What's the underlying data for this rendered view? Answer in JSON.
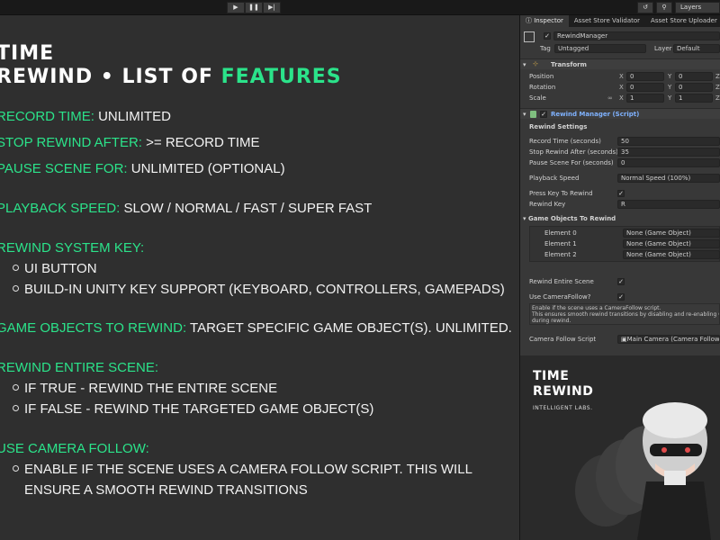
{
  "toolbar": {
    "play_icon": "▶",
    "pause_icon": "❚❚",
    "step_icon": "▶|",
    "history_icon": "↺",
    "search_icon": "⚲",
    "layers_label": "Layers"
  },
  "features": {
    "title_line1": "TIME",
    "title_line2_plain": "REWIND • LIST OF ",
    "title_line2_accent": "FEATURES",
    "record_time_key": "RECORD TIME:",
    "record_time_val": " UNLIMITED",
    "stop_rewind_key": "STOP REWIND AFTER:",
    "stop_rewind_val": " >= RECORD TIME",
    "pause_scene_key": "PAUSE SCENE FOR:",
    "pause_scene_val": " UNLIMITED (OPTIONAL)",
    "playback_key": "PLAYBACK SPEED:",
    "playback_val": " SLOW / NORMAL / FAST / SUPER FAST",
    "system_key_key": "REWIND SYSTEM KEY:",
    "system_key_sub1": "UI BUTTON",
    "system_key_sub2": "BUILD-IN UNITY KEY SUPPORT (KEYBOARD, CONTROLLERS, GAMEPADS)",
    "game_objects_key": "GAME OBJECTS TO REWIND:",
    "game_objects_val": " TARGET SPECIFIC GAME OBJECT(S). UNLIMITED.",
    "entire_scene_key": "REWIND ENTIRE SCENE:",
    "entire_scene_sub1": "IF TRUE  - REWIND THE ENTIRE SCENE",
    "entire_scene_sub2": "IF FALSE - REWIND THE TARGETED GAME OBJECT(S)",
    "camera_key": "USE CAMERA FOLLOW:",
    "camera_sub1": "ENABLE IF THE SCENE USES A CAMERA FOLLOW SCRIPT. THIS WILL",
    "camera_sub2": "ENSURE A SMOOTH REWIND TRANSITIONS"
  },
  "inspector": {
    "tabs": [
      "Inspector",
      "Asset Store Validator",
      "Asset Store Uploader"
    ],
    "object_name": "RewindManager",
    "tag_label": "Tag",
    "tag_value": "Untagged",
    "layer_label": "Layer",
    "layer_value": "Default",
    "transform": {
      "title": "Transform",
      "position_label": "Position",
      "rotation_label": "Rotation",
      "scale_label": "Scale",
      "position": [
        "0",
        "0"
      ],
      "rotation": [
        "0",
        "0"
      ],
      "scale": [
        "1",
        "1"
      ],
      "x": "X",
      "y": "Y",
      "z": "Z"
    },
    "script": {
      "title": "Rewind Manager (Script)",
      "settings_header": "Rewind Settings",
      "record_time_label": "Record Time (seconds)",
      "record_time_value": "50",
      "stop_after_label": "Stop Rewind After (seconds)",
      "stop_after_value": "35",
      "pause_for_label": "Pause Scene For (seconds)",
      "pause_for_value": "0",
      "playback_label": "Playback Speed",
      "playback_value": "Normal Speed (100%)",
      "press_key_label": "Press Key To Rewind",
      "rewind_key_label": "Rewind Key",
      "rewind_key_value": "R",
      "objects_header": "Game Objects To Rewind",
      "elements": [
        {
          "label": "Element 0",
          "value": "None (Game Object)"
        },
        {
          "label": "Element 1",
          "value": "None (Game Object)"
        },
        {
          "label": "Element 2",
          "value": "None (Game Object)"
        }
      ],
      "entire_scene_label": "Rewind Entire Scene",
      "camera_follow_label": "Use CameraFollow?",
      "help_line1": "Enable if the scene uses a CameraFollow script.",
      "help_line2": "This ensures smooth rewind transitions by disabling and re-enabling Came",
      "help_line3": "during rewind.",
      "camera_script_label": "Camera Follow Script",
      "camera_script_value": "Main Camera (Camera Follow)"
    }
  },
  "brand": {
    "line1": "TIME",
    "line2": "REWIND",
    "sub": "INTELLIGENT LABS."
  },
  "colors": {
    "accent": "#2be38a",
    "background": "#2f2f2f",
    "inspector": "#383838"
  }
}
